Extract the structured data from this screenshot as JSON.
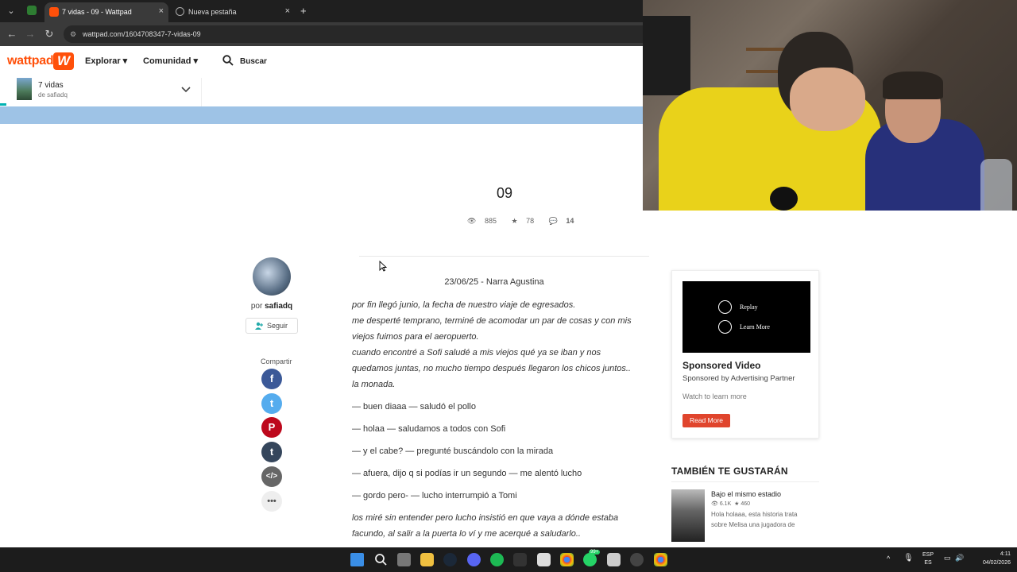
{
  "browser": {
    "tabs": [
      {
        "title": "7 vidas - 09 - Wattpad",
        "close": "×"
      },
      {
        "title": "Nueva pestaña",
        "close": "×"
      }
    ],
    "new_tab": "+",
    "url": "wattpad.com/1604708347-7-vidas-09"
  },
  "header": {
    "logo": "wattpad",
    "logo_mark": "W",
    "explore": "Explorar ▾",
    "community": "Comunidad ▾",
    "search": "Buscar"
  },
  "story": {
    "title": "7 vidas",
    "by": "de safiadq"
  },
  "chapter": {
    "title": "09",
    "reads": "885",
    "votes": "78",
    "comments": "14"
  },
  "author": {
    "por": "por",
    "name": "safiadq",
    "follow": "Seguir",
    "share_label": "Compartir"
  },
  "body": {
    "date_line": "23/06/25 - Narra Agustina",
    "p1": "por fin llegó junio, la fecha de nuestro viaje de egresados. me desperté temprano, terminé de acomodar un par de cosas y con mis viejos fuimos para el aeropuerto. cuando encontré a Sofi saludé a mis viejos qué ya se iban y nos quedamos juntas, no mucho tiempo después llegaron los chicos juntos.. la monada.",
    "p1_lines": [
      "por fin llegó junio, la fecha de nuestro viaje de egresados.",
      "me desperté temprano, terminé de acomodar un par de cosas y con mis",
      "viejos fuimos para el aeropuerto.",
      "cuando encontré a Sofi saludé a mis viejos qué ya se iban y nos",
      "quedamos juntas, no mucho tiempo después llegaron los chicos juntos..",
      "la monada."
    ],
    "d1": "— buen diaaa — saludó el pollo",
    "d2": "— holaa — saludamos a todos con Sofi",
    "d3": "— y el cabe? — pregunté buscándolo con la mirada",
    "d4": "— afuera, dijo q si podías ir un segundo — me alentó lucho",
    "d5": "— gordo pero- — lucho interrumpió a Tomi",
    "p2_lines": [
      "los miré sin entender pero lucho insistió en que vaya a dónde estaba",
      "facundo, al salir a la puerta lo ví y me acerqué a saludarlo.."
    ]
  },
  "ad": {
    "replay": "Replay",
    "learn_more": "Learn More",
    "title": "Sponsored Video",
    "sponsor": "Sponsored by Advertising Partner",
    "watch": "Watch to learn more",
    "button": "Read More"
  },
  "also": {
    "heading": "TAMBIÉN TE GUSTARÁN",
    "items": [
      {
        "title": "Bajo el mismo estadio",
        "reads": "6.1K",
        "votes": "460",
        "desc": "Hola holaaa, esta historia trata sobre Melisa una jugadora de"
      }
    ]
  },
  "taskbar": {
    "lang_top": "ESP",
    "lang_bottom": "ES",
    "time": "4:11",
    "date": "04/02/2026",
    "badge": "99+"
  },
  "colors": {
    "brand": "#ff500a",
    "ad_button": "#e0452d",
    "banner": "#9ec3e6"
  }
}
